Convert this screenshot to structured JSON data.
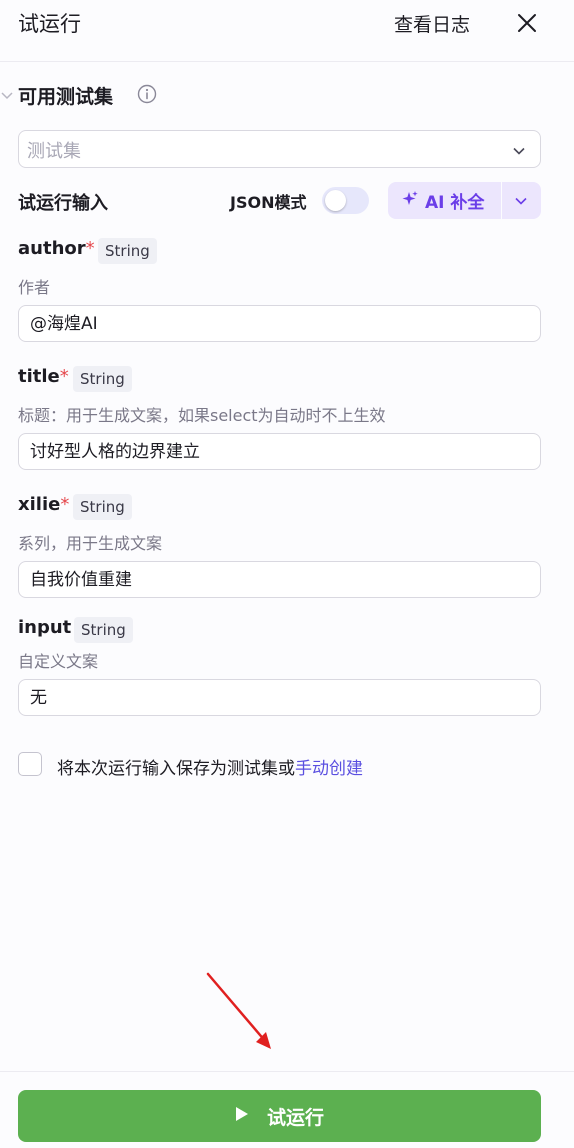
{
  "header": {
    "title": "试运行",
    "view_logs_label": "查看日志"
  },
  "test_set": {
    "section_title": "可用测试集",
    "select_placeholder": "测试集"
  },
  "run_input": {
    "label": "试运行输入",
    "json_mode_label": "JSON模式",
    "json_mode_on": false,
    "ai_complete_label": "AI 补全"
  },
  "fields": [
    {
      "name": "author",
      "required": true,
      "required_mark": "*",
      "type": "String",
      "description": "作者",
      "value": "@海煌AI"
    },
    {
      "name": "title",
      "required": true,
      "required_mark": "*",
      "type": "String",
      "description": "标题：用于生成文案，如果select为自动时不上生效",
      "value": "讨好型人格的边界建立"
    },
    {
      "name": "xilie",
      "required": true,
      "required_mark": "*",
      "type": "String",
      "description": "系列，用于生成文案",
      "value": "自我价值重建"
    },
    {
      "name": "input",
      "required": false,
      "required_mark": "",
      "type": "String",
      "description": "自定义文案",
      "value": "无"
    }
  ],
  "save": {
    "checked": false,
    "text": "将本次运行输入保存为测试集或",
    "link": "手动创建"
  },
  "footer": {
    "run_label": "试运行"
  },
  "colors": {
    "accent_purple": "#6b3ee8",
    "run_green": "#5cb050",
    "required_red": "#e5484d",
    "link_blue": "#5a4fe0",
    "annotation_red": "#e02020"
  }
}
